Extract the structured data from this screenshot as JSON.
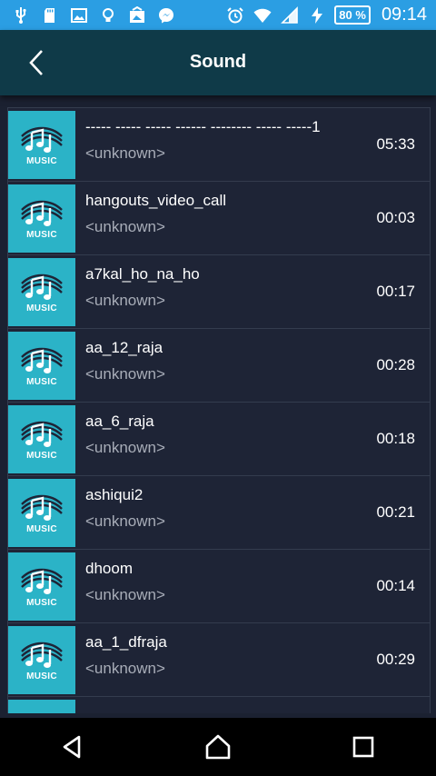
{
  "status_bar": {
    "battery_label": "80 %",
    "time": "09:14",
    "left_icons": [
      "usb-icon",
      "sd-card-icon",
      "image-icon",
      "bulb-icon",
      "gallery-icon",
      "messenger-icon"
    ],
    "right_icons": [
      "alarm-icon",
      "wifi-icon",
      "signal-icon",
      "charging-icon"
    ]
  },
  "app_bar": {
    "title": "Sound"
  },
  "tracks": [
    {
      "title": "----- ----- ----- ------ -------- ----- -----1",
      "artist": "<unknown>",
      "duration": "05:33",
      "thumb_label": "MUSIC"
    },
    {
      "title": "hangouts_video_call",
      "artist": "<unknown>",
      "duration": "00:03",
      "thumb_label": "MUSIC"
    },
    {
      "title": "a7kal_ho_na_ho",
      "artist": "<unknown>",
      "duration": "00:17",
      "thumb_label": "MUSIC"
    },
    {
      "title": "aa_12_raja",
      "artist": "<unknown>",
      "duration": "00:28",
      "thumb_label": "MUSIC"
    },
    {
      "title": "aa_6_raja",
      "artist": "<unknown>",
      "duration": "00:18",
      "thumb_label": "MUSIC"
    },
    {
      "title": "ashiqui2",
      "artist": "<unknown>",
      "duration": "00:21",
      "thumb_label": "MUSIC"
    },
    {
      "title": "dhoom",
      "artist": "<unknown>",
      "duration": "00:14",
      "thumb_label": "MUSIC"
    },
    {
      "title": "aa_1_dfraja",
      "artist": "<unknown>",
      "duration": "00:29",
      "thumb_label": "MUSIC"
    },
    {
      "title": "",
      "artist": "",
      "duration": "",
      "thumb_label": ""
    }
  ],
  "colors": {
    "status_bar": "#2b9ee3",
    "app_bar": "#0f3a48",
    "background": "#1b2131",
    "thumb": "#2bb3c7"
  }
}
